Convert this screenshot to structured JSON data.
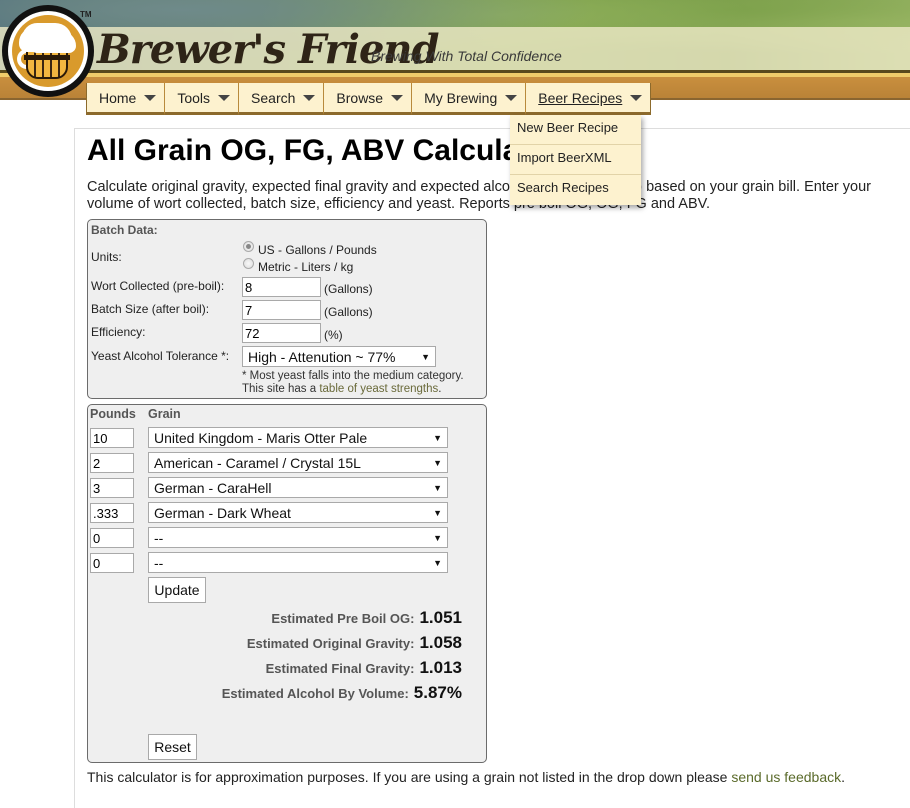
{
  "header": {
    "brand": "Brewer's Friend",
    "tagline": "Brewing With Total Confidence",
    "trademark": "TM",
    "logo_icon": "beer-mug-logo"
  },
  "nav": {
    "items": [
      {
        "label": "Home",
        "active": false
      },
      {
        "label": "Tools",
        "active": false
      },
      {
        "label": "Search",
        "active": false
      },
      {
        "label": "Browse",
        "active": false
      },
      {
        "label": "My Brewing",
        "active": false
      },
      {
        "label": "Beer Recipes",
        "active": true
      }
    ],
    "dropdown": {
      "items": [
        "New Beer Recipe",
        "Import BeerXML",
        "Search Recipes"
      ]
    }
  },
  "page": {
    "title": "All Grain OG, FG, ABV Calculator",
    "intro": "Calculate original gravity, expected final gravity and expected alcohol by volume (ABV) based on your grain bill. Enter your volume of wort collected, batch size, efficiency and yeast. Reports pre boil OG, OG, FG and ABV."
  },
  "batch": {
    "title": "Batch Data:",
    "units_label": "Units:",
    "units_options": [
      {
        "label": "US - Gallons / Pounds",
        "checked": true
      },
      {
        "label": "Metric - Liters / kg",
        "checked": false
      }
    ],
    "wort_label": "Wort Collected (pre-boil):",
    "wort_value": "8",
    "wort_unit": "(Gallons)",
    "batch_label": "Batch Size (after boil):",
    "batch_value": "7",
    "batch_unit": "(Gallons)",
    "eff_label": "Efficiency:",
    "eff_value": "72",
    "eff_unit": "(%)",
    "yeast_label": "Yeast Alcohol Tolerance *:",
    "yeast_value": "High - Attenution ~ 77%",
    "note_line1": "* Most yeast falls into the medium category.",
    "note_line2_prefix": "This site has a ",
    "note_link": "table of yeast strengths",
    "note_suffix": "."
  },
  "grains": {
    "col_pounds": "Pounds",
    "col_grain": "Grain",
    "rows": [
      {
        "pounds": "10",
        "grain": "United Kingdom - Maris Otter Pale"
      },
      {
        "pounds": "2",
        "grain": "American - Caramel / Crystal 15L"
      },
      {
        "pounds": "3",
        "grain": "German - CaraHell"
      },
      {
        "pounds": ".333",
        "grain": "German - Dark Wheat"
      },
      {
        "pounds": "0",
        "grain": "--"
      },
      {
        "pounds": "0",
        "grain": "--"
      }
    ],
    "update_label": "Update",
    "reset_label": "Reset"
  },
  "results": {
    "pre_boil_og_label": "Estimated Pre Boil OG:",
    "pre_boil_og": "1.051",
    "og_label": "Estimated Original Gravity:",
    "og": "1.058",
    "fg_label": "Estimated Final Gravity:",
    "fg": "1.013",
    "abv_label": "Estimated Alcohol By Volume:",
    "abv": "5.87%"
  },
  "footer": {
    "text": "This calculator is for approximation purposes. If you are using a grain not listed in the drop down please ",
    "link": "send us feedback",
    "suffix": "."
  }
}
